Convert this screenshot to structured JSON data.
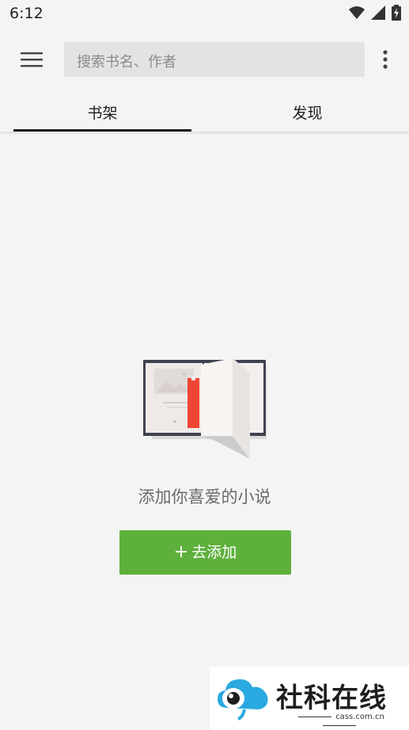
{
  "status_bar": {
    "time": "6:12",
    "icons": [
      "wifi-icon",
      "signal-icon",
      "battery-charging-icon"
    ]
  },
  "toolbar": {
    "menu_icon": "hamburger-menu-icon",
    "search_placeholder": "搜索书名、作者",
    "more_icon": "more-vert-icon"
  },
  "tabs": [
    {
      "label": "书架",
      "selected": true
    },
    {
      "label": "发现",
      "selected": false
    }
  ],
  "empty_state": {
    "illustration": "open-book-illustration",
    "message": "添加你喜爱的小说",
    "button_label": "去添加",
    "button_icon": "plus-icon"
  },
  "colors": {
    "background": "#f4f4f4",
    "accent_green": "#5eb03c",
    "tab_indicator": "#1a1a1a",
    "bookmark_red": "#f04535"
  },
  "watermark": {
    "text": "社科在线",
    "subtext": "cass.com.cn"
  }
}
